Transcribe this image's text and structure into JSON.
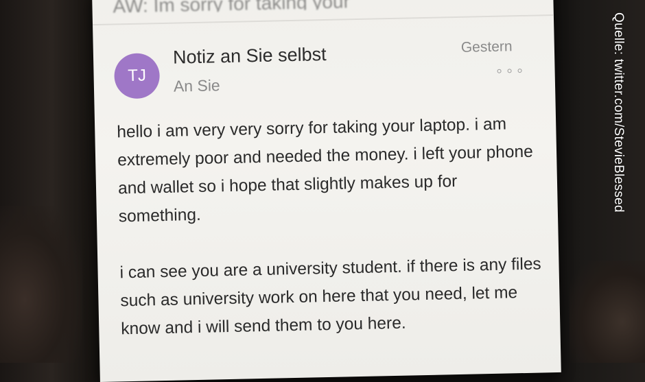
{
  "previous_message": {
    "subject_partial": "AW: Im sorry for taking your"
  },
  "message": {
    "avatar_initials": "TJ",
    "sender": "Notiz an Sie selbst",
    "recipient": "An Sie",
    "date": "Gestern",
    "more_icon": "ellipsis-icon",
    "paragraphs": [
      "hello i am very very sorry for taking your laptop. i am extremely poor and needed the money. i left your phone and wallet so i hope that slightly makes up for something.",
      "i can see you are a university student. if there is any files such as university work on here that you need, let me know and i will send them to you here."
    ]
  },
  "watermark": "Quelle: twitter.com/StevieBlessed",
  "colors": {
    "avatar": "#9f77c7",
    "screen_bg": "#f1f0ec",
    "secondary_text": "#8a8a8a"
  }
}
